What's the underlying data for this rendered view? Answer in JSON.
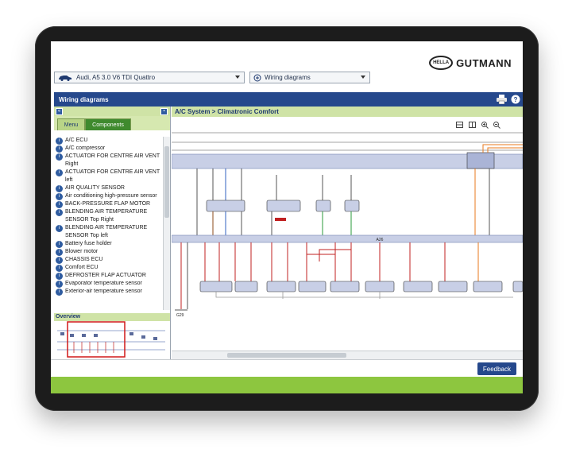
{
  "brand": {
    "badge": "HELLA",
    "name": "GUTMANN"
  },
  "vehicle_select": {
    "value": "Audi, A5 3.0 V6 TDI Quattro",
    "icon": "car-icon"
  },
  "function_select": {
    "value": "Wiring diagrams",
    "icon": "wiring-icon"
  },
  "window": {
    "title": "Wiring diagrams",
    "print_icon": "printer-icon",
    "help_icon": "help-icon"
  },
  "left_pane": {
    "collapse_icon": "double-chevron-left-icon",
    "pin_icon": "pin-icon",
    "tabs": [
      {
        "label": "Menu",
        "active": false
      },
      {
        "label": "Components",
        "active": true
      }
    ],
    "components": [
      "A/C ECU",
      "A/C compressor",
      "ACTUATOR FOR CENTRE AIR VENT Right",
      "ACTUATOR FOR CENTRE AIR VENT left",
      "AIR QUALITY SENSOR",
      "Air conditioning high-pressure sensor",
      "BACK-PRESSURE FLAP MOTOR",
      "BLENDING AIR TEMPERATURE SENSOR Top Right",
      "BLENDING AIR TEMPERATURE SENSOR Top left",
      "Battery fuse holder",
      "Blower motor",
      "CHASSIS ECU",
      "Comfort ECU",
      "DEFROSTER FLAP ACTUATOR",
      "Evaporator temperature sensor",
      "Exterior-air temperature sensor"
    ],
    "overview_label": "Overview"
  },
  "diagram": {
    "breadcrumb": "A/C System > Climatronic Comfort",
    "bus_label": "A26",
    "ground_label": "G29",
    "toolbar_icons": [
      "fit-page-icon",
      "fit-width-icon",
      "zoom-in-icon",
      "zoom-out-icon"
    ]
  },
  "feedback_label": "Feedback",
  "colors": {
    "accent_blue": "#25488c",
    "green": "#8dc63f",
    "light_green": "#cfe3a6"
  }
}
